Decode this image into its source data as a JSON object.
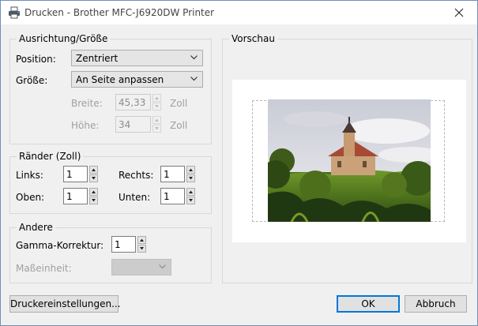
{
  "window": {
    "title": "Drucken - Brother MFC-J6920DW Printer",
    "icons": {
      "app": "printer-icon",
      "close": "close-icon"
    }
  },
  "orientation": {
    "group_label": "Ausrichtung/Größe",
    "position_label": "Position:",
    "position_value": "Zentriert",
    "size_label": "Größe:",
    "size_value": "An Seite anpassen",
    "width_label": "Breite:",
    "width_value": "45,33",
    "width_unit": "Zoll",
    "height_label": "Höhe:",
    "height_value": "34",
    "height_unit": "Zoll"
  },
  "margins": {
    "group_label": "Ränder (Zoll)",
    "left_label": "Links:",
    "left_value": "1",
    "right_label": "Rechts:",
    "right_value": "1",
    "top_label": "Oben:",
    "top_value": "1",
    "bottom_label": "Unten:",
    "bottom_value": "1"
  },
  "other": {
    "group_label": "Andere",
    "gamma_label": "Gamma-Korrektur:",
    "gamma_value": "1",
    "unit_label": "Maßeinheit:",
    "unit_value": ""
  },
  "preview": {
    "group_label": "Vorschau",
    "image": "church-on-hill-photo"
  },
  "buttons": {
    "printer_settings": "Druckereinstellungen...",
    "ok": "OK",
    "cancel": "Abbruch"
  },
  "colors": {
    "accent": "#0078d7",
    "dialog_bg": "#f0f0f0",
    "group_border": "#d8d8d8",
    "disabled_text": "#a0a0a0"
  }
}
